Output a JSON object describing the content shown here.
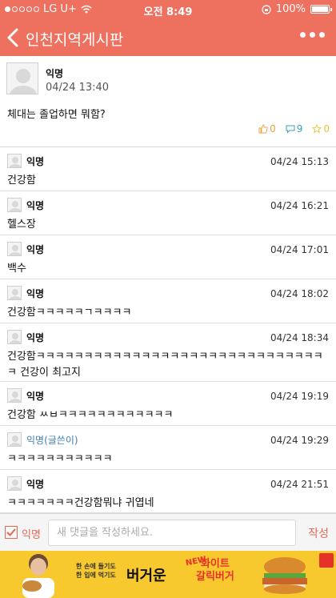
{
  "status_bar": {
    "carrier": "LG U+",
    "time": "오전 8:49",
    "battery": "100%",
    "battery_level": 1.0
  },
  "nav": {
    "title": "인천지역게시판",
    "back_icon": "chevron-left-icon",
    "more_icon": "more-dots-icon"
  },
  "post": {
    "author": "익명",
    "time": "04/24 13:40",
    "body": "체대는 졸업하면 뭐함?",
    "likes": "0",
    "comments": "9",
    "scraps": "0"
  },
  "comments": [
    {
      "author": "익명",
      "time": "04/24 15:13",
      "text": "건강함"
    },
    {
      "author": "익명",
      "time": "04/24 16:21",
      "text": "헬스장"
    },
    {
      "author": "익명",
      "time": "04/24 17:01",
      "text": "백수"
    },
    {
      "author": "익명",
      "time": "04/24 18:02",
      "text": "건강함ㅋㅋㅋㅋㅋㄱㅋㅋㅋㅋ"
    },
    {
      "author": "익명",
      "time": "04/24 18:34",
      "text": "건강함ㅋㅋㅋㅋㅋㅋㅋㅋㅋㅋㅋㅋㅋㅋㅋㅋㅋㅋㅋㅋㅋㅋㅋㅋㅋㅋㅋㅋㅋㅋ ㅋ 건강이 최고지"
    },
    {
      "author": "익명",
      "time": "04/24 19:19",
      "text": "건강함 ㅆㅂㅋㅋㅋㅋㅋㅋㅋㅋㅋㅋㅋㅋ"
    },
    {
      "author": "익명(글쓴이)",
      "time": "04/24 19:29",
      "text": "ㅋㅋㅋㅋㅋㅋㅋㅋㅋㅋㅋ"
    },
    {
      "author": "익명",
      "time": "04/24 21:51",
      "text": "ㅋㅋㅋㅋㅋㅋㅋ건강함뭐냐 귀엽네"
    }
  ],
  "input_bar": {
    "anonymous_label": "익명",
    "anonymous_checked": true,
    "placeholder": "새 댓글을 작성하세요.",
    "value": "",
    "submit_label": "작성"
  },
  "ad": {
    "line1": "한 손에 들기도",
    "line2": "한 입에 먹기도",
    "headline": "버거운",
    "new_tag": "NEW",
    "product_line1": "화이트",
    "product_line2": "갈릭버거"
  },
  "colors": {
    "accent": "#ee705f",
    "writer_name": "#3f7fb5",
    "ad_background": "#f7c92e"
  }
}
